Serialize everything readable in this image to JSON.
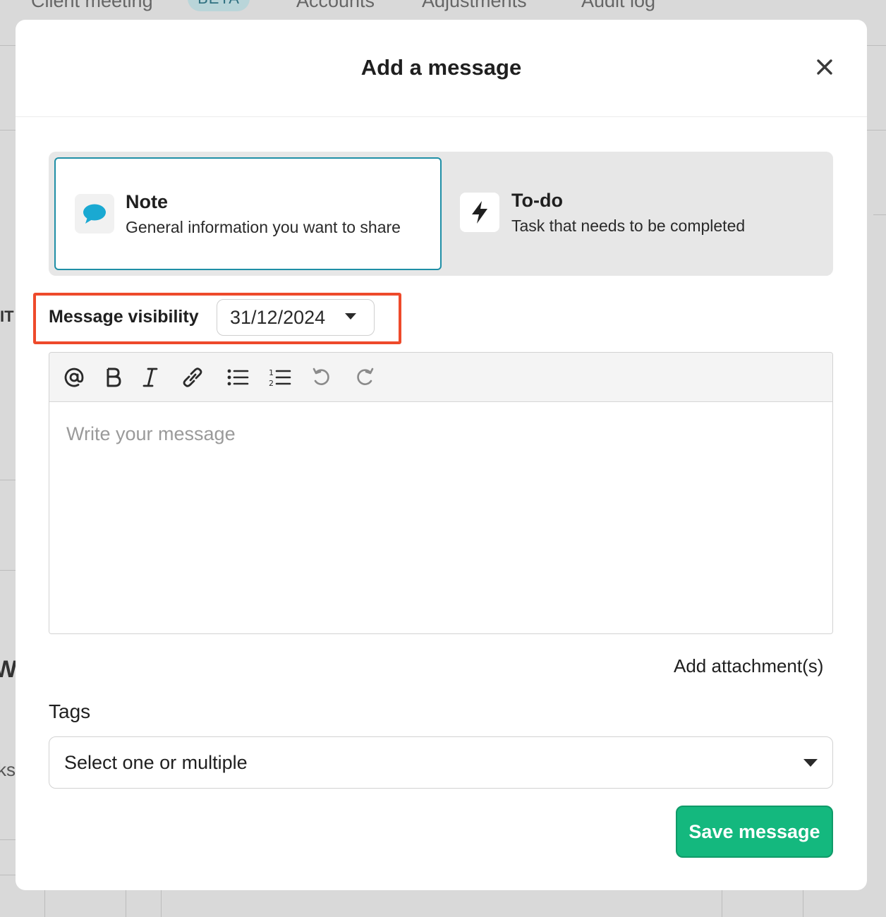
{
  "background": {
    "tabs": [
      {
        "label": "Client meeting"
      },
      {
        "label": "Accounts"
      },
      {
        "label": "Adjustments"
      },
      {
        "label": "Audit log"
      }
    ],
    "badge": "BETA",
    "fragments": {
      "left_it": "IT",
      "left_w": "W",
      "left_ks": "ks"
    }
  },
  "modal": {
    "title": "Add a message",
    "types": [
      {
        "title": "Note",
        "description": "General information you want to share",
        "icon": "speech-bubble-icon",
        "selected": true
      },
      {
        "title": "To-do",
        "description": "Task that needs to be completed",
        "icon": "lightning-bolt-icon",
        "selected": false
      }
    ],
    "visibility": {
      "label": "Message visibility",
      "value": "31/12/2024"
    },
    "editor": {
      "toolbar": [
        "mention-icon",
        "bold-icon",
        "italic-icon",
        "link-icon",
        "bullet-list-icon",
        "numbered-list-icon",
        "undo-icon",
        "redo-icon"
      ],
      "placeholder": "Write your message"
    },
    "attachment_label": "Add attachment(s)",
    "tags": {
      "label": "Tags",
      "placeholder": "Select one or multiple"
    },
    "save_label": "Save message"
  },
  "colors": {
    "accent": "#1f8fa6",
    "save_green": "#14b87e",
    "highlight_red": "#ee4a2b",
    "note_icon": "#1aa9d2"
  }
}
